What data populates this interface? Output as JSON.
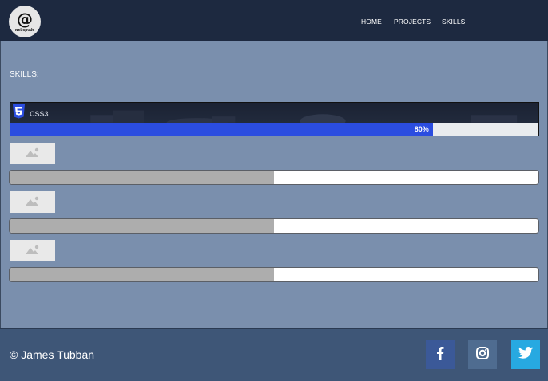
{
  "header": {
    "logo_symbol": "@",
    "logo_text": "webspode",
    "nav": [
      {
        "label": "HOME"
      },
      {
        "label": "PROJECTS"
      },
      {
        "label": "SKILLS"
      }
    ]
  },
  "main": {
    "heading": "SKILLS:",
    "featured_skill": {
      "name": "CSS3",
      "icon": "css3-icon",
      "progress_label": "80%",
      "progress": 0.8,
      "bar_color": "#2b4de0"
    },
    "skills": [
      {
        "icon": "image-placeholder-icon",
        "progress": 0.5
      },
      {
        "icon": "image-placeholder-icon",
        "progress": 0.5
      },
      {
        "icon": "image-placeholder-icon",
        "progress": 0.5
      }
    ]
  },
  "footer": {
    "copyright": "© James Tubban",
    "social": [
      {
        "name": "facebook",
        "icon": "facebook-icon",
        "color": "#3b5998"
      },
      {
        "name": "instagram",
        "icon": "instagram-icon",
        "color": "#4f6c90"
      },
      {
        "name": "twitter",
        "icon": "twitter-icon",
        "color": "#27a9e1"
      }
    ]
  },
  "colors": {
    "header_bg": "#1d2940",
    "body_bg": "#7a8fad",
    "footer_bg": "#3e5677"
  }
}
